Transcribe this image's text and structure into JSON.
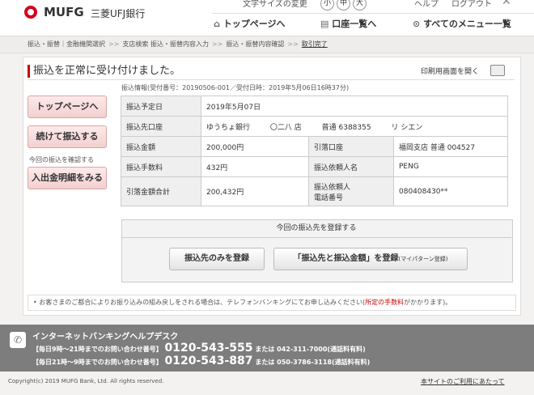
{
  "header": {
    "logo_name": "MUFG",
    "bank_name": "三菱UFJ銀行",
    "font_change_label": "文字サイズの変更",
    "size_small": "小",
    "size_medium": "中",
    "size_large": "大",
    "help_label": "ヘルプ",
    "logout_label": "ログアウト",
    "nav_top": "トップページへ",
    "nav_accounts": "口座一覧へ",
    "nav_menu": "すべてのメニュー一覧"
  },
  "breadcrumb": {
    "items": [
      "振込・振替｜金融機関選択",
      "支店検索 振込・振替内容入力",
      "振込・振替内容確認",
      "取引完了"
    ]
  },
  "main": {
    "title": "振込を正常に受け付けました。",
    "print_label": "印刷用画面を開く",
    "transfer_info": "振込情報(受付番号：20190506-001／受付日時：2019年5月06日16時37分)"
  },
  "sidebar": {
    "top_button": "トップページへ",
    "continue_button": "続けて振込する",
    "confirm_note": "今回の振込を確認する",
    "statement_button": "入出金明細をみる"
  },
  "details": {
    "scheduled_date_label": "振込予定日",
    "scheduled_date": "2019年5月07日",
    "dest_account_label": "振込先口座",
    "dest_bank": "ゆうちょ銀行",
    "dest_branch": "〇二八 店",
    "dest_type": "普通 6388355",
    "dest_name": "リ シエン",
    "amount_label": "振込金額",
    "amount": "200,000円",
    "withdraw_account_label": "引落口座",
    "withdraw_account": "福岡支店 普通 004527",
    "fee_label": "振込手数料",
    "fee": "432円",
    "requester_name_label": "振込依頼人名",
    "requester_name": "PENG",
    "total_label": "引落金額合計",
    "total": "200,432円",
    "requester_phone_label_1": "振込依頼人",
    "requester_phone_label_2": "電話番号",
    "requester_phone": "080408430**"
  },
  "register": {
    "header": "今回の振込先を登録する",
    "btn_dest_only": "振込先のみを登録",
    "btn_dest_amount": "「振込先と振込金額」を登録",
    "btn_dest_amount_sub": "(マイパターン登録)"
  },
  "notice": {
    "text_1": "• お客さまのご都合によりお振り込みの組み戻しをされる場合は、テレフォンバンキングにてお申し込みください(",
    "text_red": "所定の手数料",
    "text_2": "がかかります)。"
  },
  "footer": {
    "helpdesk_title": "インターネットバンキングヘルプデスク",
    "row1_label": "【毎日9時～21時までのお問い合わせ番号】",
    "row1_number": "0120-543-555",
    "row1_alt": "または 042-311-7000(通話料有料)",
    "row2_label": "【毎日21時～9時までのお問い合わせ番号】",
    "row2_number": "0120-543-887",
    "row2_alt": "または 050-3786-3118(通話料有料)",
    "copyright": "Copyright(c) 2019 MUFG Bank, Ltd. All rights reserved.",
    "usage_link": "本サイトのご利用にあたって"
  },
  "colors": {
    "brand_red": "#d6001c",
    "footer_gray": "#7d7d7d"
  }
}
